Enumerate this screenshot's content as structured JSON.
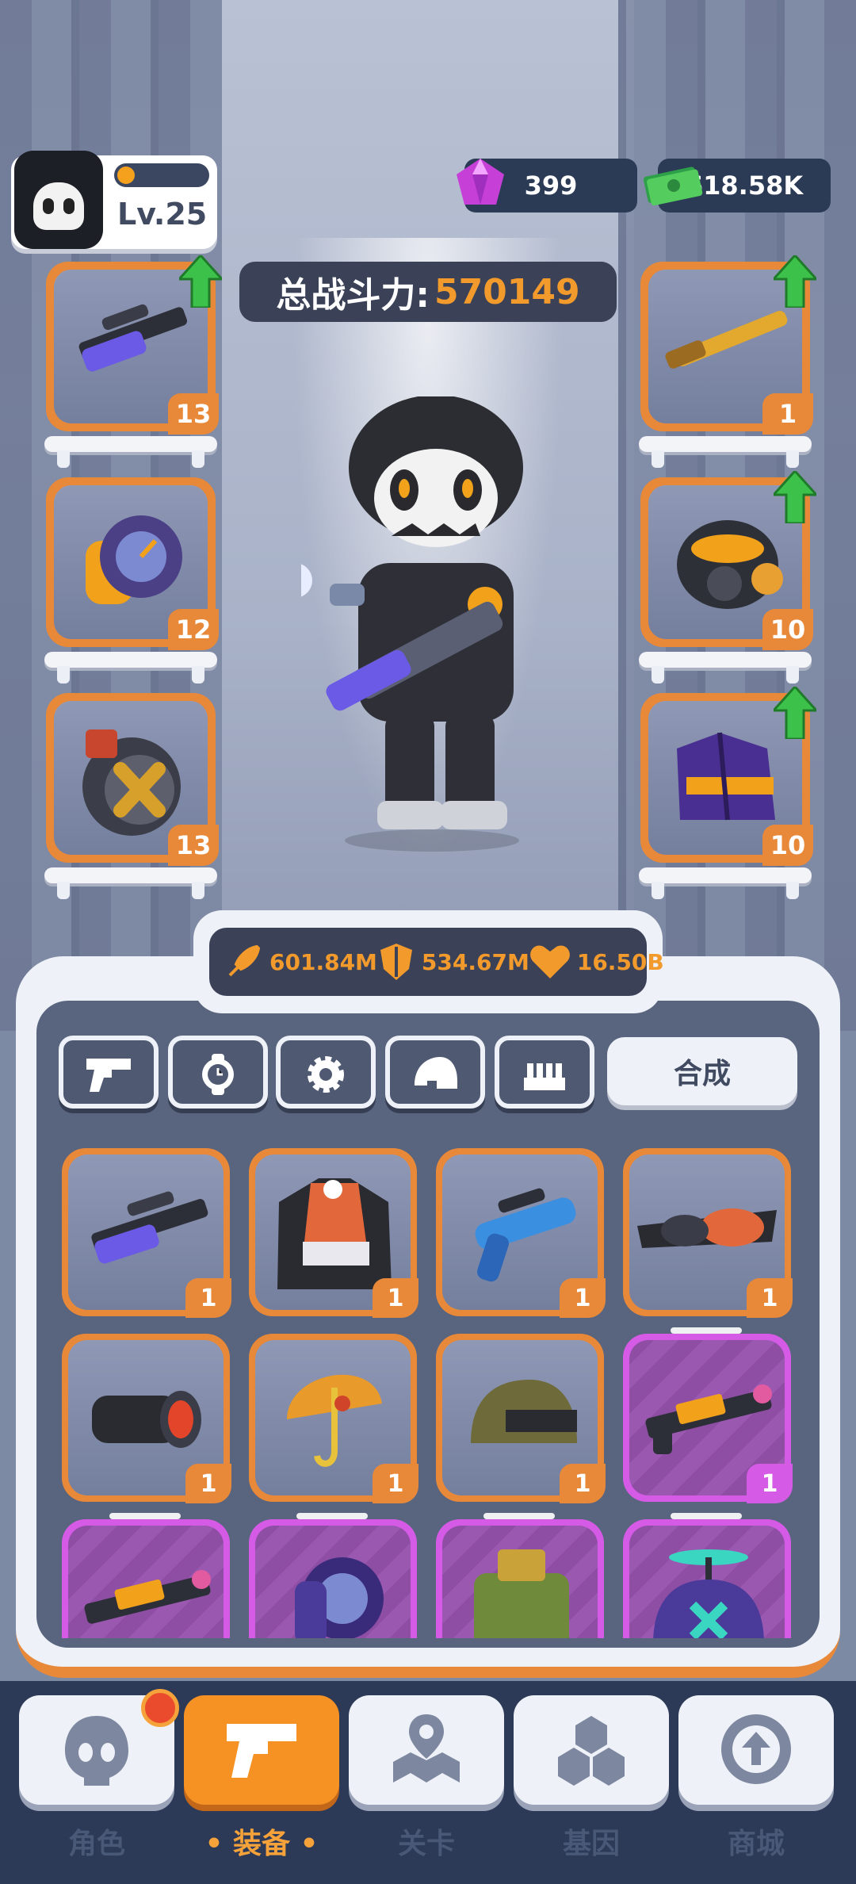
{
  "player": {
    "level": "Lv.25"
  },
  "currency": {
    "gems": "399",
    "cash": "618.58K"
  },
  "power": {
    "label": "总战斗力:",
    "value": "570149"
  },
  "equipped": {
    "left": [
      {
        "name": "purple-rifle",
        "count": "13",
        "upgrade": true
      },
      {
        "name": "wrist-gauge",
        "count": "12",
        "upgrade": false
      },
      {
        "name": "ammo-drum",
        "count": "13",
        "upgrade": false
      }
    ],
    "right": [
      {
        "name": "gold-shotgun",
        "count": "1",
        "upgrade": true
      },
      {
        "name": "gas-mask",
        "count": "10",
        "upgrade": true
      },
      {
        "name": "purple-jacket",
        "count": "10",
        "upgrade": true
      }
    ]
  },
  "stats": {
    "attack": "601.84M",
    "defense": "534.67M",
    "hp": "16.50B"
  },
  "tabs": {
    "merge_label": "合成",
    "icons": [
      "gun-icon",
      "watch-icon",
      "gear-icon",
      "helmet-icon",
      "ammo-icon"
    ]
  },
  "inventory": [
    {
      "name": "purple-rifle",
      "count": "1",
      "rarity": "orange"
    },
    {
      "name": "racing-jacket",
      "count": "1",
      "rarity": "orange"
    },
    {
      "name": "blue-flare-gun",
      "count": "1",
      "rarity": "orange"
    },
    {
      "name": "orange-goggles",
      "count": "1",
      "rarity": "orange"
    },
    {
      "name": "scope",
      "count": "1",
      "rarity": "orange"
    },
    {
      "name": "orange-umbrella",
      "count": "1",
      "rarity": "orange"
    },
    {
      "name": "army-helmet",
      "count": "1",
      "rarity": "orange"
    },
    {
      "name": "pink-smg",
      "count": "1",
      "rarity": "purple"
    },
    {
      "name": "pink-smg",
      "count": "",
      "rarity": "purple"
    },
    {
      "name": "purple-watch",
      "count": "",
      "rarity": "purple"
    },
    {
      "name": "green-ammo-box",
      "count": "",
      "rarity": "purple"
    },
    {
      "name": "propeller-cap",
      "count": "",
      "rarity": "purple"
    }
  ],
  "nav": [
    {
      "label": "角色",
      "icon": "skull-icon",
      "active": false
    },
    {
      "label": "装备",
      "icon": "gun-icon",
      "active": true
    },
    {
      "label": "关卡",
      "icon": "map-icon",
      "active": false
    },
    {
      "label": "基因",
      "icon": "hex-icon",
      "active": false
    },
    {
      "label": "商城",
      "icon": "shop-icon",
      "active": false
    }
  ],
  "colors": {
    "accent": "#f29a2b",
    "rare_orange": "#e8893a",
    "rare_purple": "#d55be6",
    "panel_dark": "#3b4258"
  }
}
